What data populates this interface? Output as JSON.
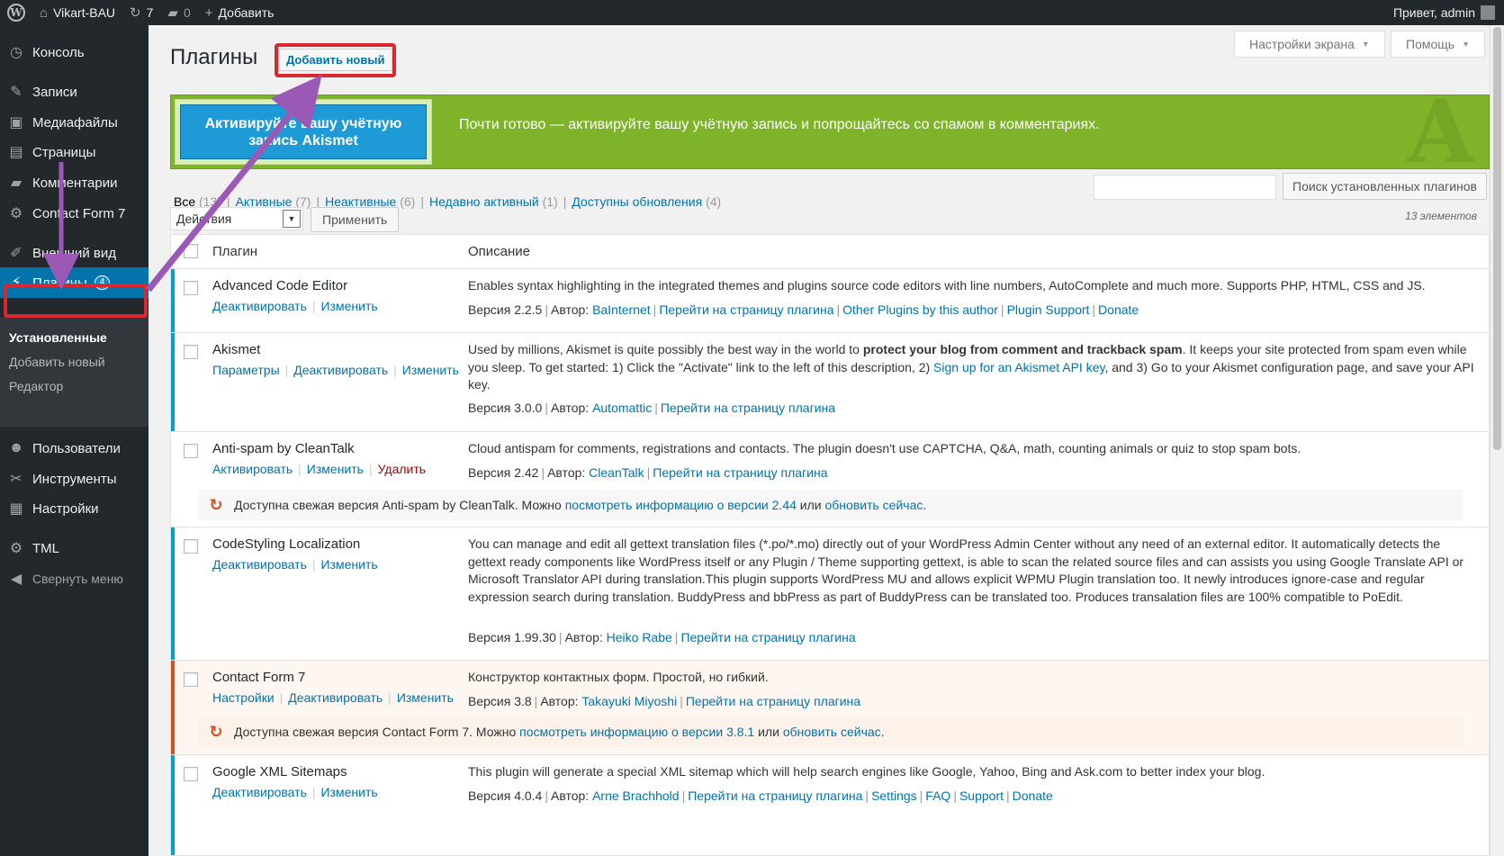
{
  "admin_bar": {
    "site_name": "Vikart-BAU",
    "updates_count": "7",
    "comments_count": "0",
    "add_label": "Добавить",
    "greeting": "Привет, admin"
  },
  "sidebar": {
    "items": [
      {
        "label": "Консоль"
      },
      {
        "label": "Записи"
      },
      {
        "label": "Медиафайлы"
      },
      {
        "label": "Страницы"
      },
      {
        "label": "Комментарии"
      },
      {
        "label": "Contact Form 7"
      },
      {
        "label": "Внешний вид"
      },
      {
        "label": "Плагины",
        "badge": "4"
      },
      {
        "label": "Пользователи"
      },
      {
        "label": "Инструменты"
      },
      {
        "label": "Настройки"
      },
      {
        "label": "TML"
      },
      {
        "label": "Свернуть меню"
      }
    ],
    "submenu": [
      {
        "label": "Установленные"
      },
      {
        "label": "Добавить новый"
      },
      {
        "label": "Редактор"
      }
    ]
  },
  "header": {
    "title": "Плагины",
    "add_new": "Добавить новый",
    "screen_options": "Настройки экрана",
    "help": "Помощь"
  },
  "akismet": {
    "button": "Активируйте вашу учётную запись Akismet",
    "text": "Почти готово — активируйте вашу учётную запись и попрощайтесь со спамом в комментариях.",
    "logo": "A"
  },
  "filters": {
    "all": "Все",
    "all_count": "(13)",
    "active": "Активные",
    "active_count": "(7)",
    "inactive": "Неактивные",
    "inactive_count": "(6)",
    "recent": "Недавно активный",
    "recent_count": "(1)",
    "updates": "Доступны обновления",
    "updates_count": "(4)"
  },
  "search": {
    "button": "Поиск установленных плагинов",
    "value": ""
  },
  "bulk": {
    "selected": "Действия",
    "apply": "Применить",
    "item_count": "13 элементов"
  },
  "table": {
    "col_plugin": "Плагин",
    "col_description": "Описание",
    "plugins": [
      {
        "name": "Advanced Code Editor",
        "actions": [
          "Деактивировать",
          "Изменить"
        ],
        "description": "Enables syntax highlighting in the integrated themes and plugins source code editors with line numbers, AutoComplete and much more. Supports PHP, HTML, CSS and JS.",
        "version": "Версия 2.2.5",
        "author_label": "Автор:",
        "author": "BaInternet",
        "links": [
          "Перейти на страницу плагина",
          "Other Plugins by this author",
          "Plugin Support",
          "Donate"
        ]
      },
      {
        "name": "Akismet",
        "actions": [
          "Параметры",
          "Деактивировать",
          "Изменить"
        ],
        "description_pre": "Used by millions, Akismet is quite possibly the best way in the world to ",
        "description_bold": "protect your blog from comment and trackback spam",
        "description_mid": ". It keeps your site protected from spam even while you sleep. To get started: 1) Click the \"Activate\" link to the left of this description, 2) ",
        "description_link": "Sign up for an Akismet API key",
        "description_post": ", and 3) Go to your Akismet configuration page, and save your API key.",
        "version": "Версия 3.0.0",
        "author_label": "Автор:",
        "author": "Automattic",
        "links": [
          "Перейти на страницу плагина"
        ]
      },
      {
        "name": "Anti-spam by CleanTalk",
        "actions": [
          "Активировать",
          "Изменить",
          "Удалить"
        ],
        "description": "Cloud antispam for comments, registrations and contacts. The plugin doesn't use CAPTCHA, Q&A, math, counting animals or quiz to stop spam bots.",
        "version": "Версия 2.42",
        "author_label": "Автор:",
        "author": "CleanTalk",
        "links": [
          "Перейти на страницу плагина"
        ],
        "update_pre": "Доступна свежая версия Anti-spam by CleanTalk. Можно ",
        "update_link1": "посмотреть информацию о версии 2.44",
        "update_mid": " или ",
        "update_link2": "обновить сейчас",
        "update_post": "."
      },
      {
        "name": "CodeStyling Localization",
        "actions": [
          "Деактивировать",
          "Изменить"
        ],
        "description": "You can manage and edit all gettext translation files (*.po/*.mo) directly out of your WordPress Admin Center without any need of an external editor. It automatically detects the gettext ready components like WordPress itself or any Plugin / Theme supporting gettext, is able to scan the related source files and can assists you using Google Translate API or Microsoft Translator API during translation.This plugin supports WordPress MU and allows explicit WPMU Plugin translation too. It newly introduces ignore-case and regular expression search during translation. BuddyPress and bbPress as part of BuddyPress can be translated too. Produces transalation files are 100% compatible to PoEdit.",
        "version": "Версия 1.99.30",
        "author_label": "Автор:",
        "author": "Heiko Rabe",
        "links": [
          "Перейти на страницу плагина"
        ]
      },
      {
        "name": "Contact Form 7",
        "actions": [
          "Настройки",
          "Деактивировать",
          "Изменить"
        ],
        "description": "Конструктор контактных форм. Простой, но гибкий.",
        "version": "Версия 3.8",
        "author_label": "Автор:",
        "author": "Takayuki Miyoshi",
        "links": [
          "Перейти на страницу плагина"
        ],
        "update_pre": "Доступна свежая версия Contact Form 7. Можно ",
        "update_link1": "посмотреть информацию о версии 3.8.1",
        "update_mid": " или ",
        "update_link2": "обновить сейчас",
        "update_post": "."
      },
      {
        "name": "Google XML Sitemaps",
        "actions": [
          "Деактивировать",
          "Изменить"
        ],
        "description": "This plugin will generate a special XML sitemap which will help search engines like Google, Yahoo, Bing and Ask.com to better index your blog.",
        "version": "Версия 4.0.4",
        "author_label": "Автор:",
        "author": "Arne Brachhold",
        "links": [
          "Перейти на страницу плагина",
          "Settings",
          "FAQ",
          "Support",
          "Donate"
        ]
      }
    ]
  },
  "colors": {
    "admin_bar": "#23282d",
    "accent": "#0073aa",
    "active_border": "#00a0d2",
    "update_border": "#d54e21",
    "akismet_green": "#7fb42a",
    "annotation_red": "#d9282e",
    "annotation_arrow": "#9b59b6"
  }
}
